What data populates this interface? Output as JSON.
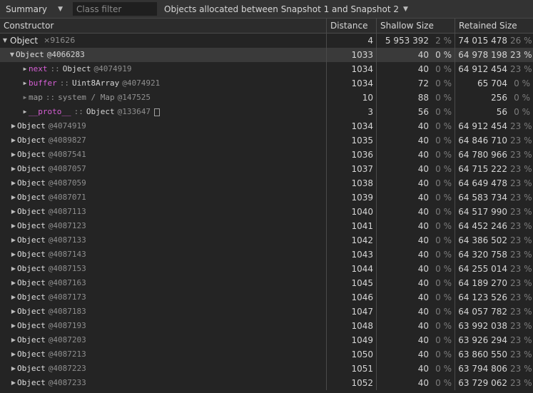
{
  "toolbar": {
    "view_select": "Summary",
    "filter_placeholder": "Class filter",
    "objects_select": "Objects allocated between Snapshot 1 and Snapshot 2"
  },
  "columns": {
    "constructor": "Constructor",
    "distance": "Distance",
    "shallow": "Shallow Size",
    "retained": "Retained Size"
  },
  "root": {
    "name": "Object",
    "count": "×91626",
    "distance": "4",
    "shallow": "5 953 392",
    "shallow_pct": "2 %",
    "retained": "74 015 478",
    "retained_pct": "26 %"
  },
  "selected": {
    "name": "Object",
    "id": "@4066283",
    "distance": "1033",
    "shallow": "40",
    "shallow_pct": "0 %",
    "retained": "64 978 198",
    "retained_pct": "23 %"
  },
  "children": [
    {
      "prop": "next",
      "sep": "::",
      "type": "Object",
      "id": "@4074919",
      "distance": "1034",
      "shallow": "40",
      "shallow_pct": "0 %",
      "retained": "64 912 454",
      "retained_pct": "23 %"
    },
    {
      "prop": "buffer",
      "sep": "::",
      "type": "Uint8Array",
      "id": "@4074921",
      "distance": "1034",
      "shallow": "72",
      "shallow_pct": "0 %",
      "retained": "65 704",
      "retained_pct": "0 %"
    },
    {
      "prop": "map",
      "sep": "::",
      "type": "system / Map",
      "id": "@147525",
      "distance": "10",
      "shallow": "88",
      "shallow_pct": "0 %",
      "retained": "256",
      "retained_pct": "0 %"
    },
    {
      "prop": "__proto__",
      "sep": "::",
      "type": "Object",
      "id": "@133647",
      "distance": "3",
      "shallow": "56",
      "shallow_pct": "0 %",
      "retained": "56",
      "retained_pct": "0 %"
    }
  ],
  "objects": [
    {
      "name": "Object",
      "id": "@4074919",
      "distance": "1034",
      "shallow": "40",
      "shallow_pct": "0 %",
      "retained": "64 912 454",
      "retained_pct": "23 %"
    },
    {
      "name": "Object",
      "id": "@4089827",
      "distance": "1035",
      "shallow": "40",
      "shallow_pct": "0 %",
      "retained": "64 846 710",
      "retained_pct": "23 %"
    },
    {
      "name": "Object",
      "id": "@4087541",
      "distance": "1036",
      "shallow": "40",
      "shallow_pct": "0 %",
      "retained": "64 780 966",
      "retained_pct": "23 %"
    },
    {
      "name": "Object",
      "id": "@4087057",
      "distance": "1037",
      "shallow": "40",
      "shallow_pct": "0 %",
      "retained": "64 715 222",
      "retained_pct": "23 %"
    },
    {
      "name": "Object",
      "id": "@4087059",
      "distance": "1038",
      "shallow": "40",
      "shallow_pct": "0 %",
      "retained": "64 649 478",
      "retained_pct": "23 %"
    },
    {
      "name": "Object",
      "id": "@4087071",
      "distance": "1039",
      "shallow": "40",
      "shallow_pct": "0 %",
      "retained": "64 583 734",
      "retained_pct": "23 %"
    },
    {
      "name": "Object",
      "id": "@4087113",
      "distance": "1040",
      "shallow": "40",
      "shallow_pct": "0 %",
      "retained": "64 517 990",
      "retained_pct": "23 %"
    },
    {
      "name": "Object",
      "id": "@4087123",
      "distance": "1041",
      "shallow": "40",
      "shallow_pct": "0 %",
      "retained": "64 452 246",
      "retained_pct": "23 %"
    },
    {
      "name": "Object",
      "id": "@4087133",
      "distance": "1042",
      "shallow": "40",
      "shallow_pct": "0 %",
      "retained": "64 386 502",
      "retained_pct": "23 %"
    },
    {
      "name": "Object",
      "id": "@4087143",
      "distance": "1043",
      "shallow": "40",
      "shallow_pct": "0 %",
      "retained": "64 320 758",
      "retained_pct": "23 %"
    },
    {
      "name": "Object",
      "id": "@4087153",
      "distance": "1044",
      "shallow": "40",
      "shallow_pct": "0 %",
      "retained": "64 255 014",
      "retained_pct": "23 %"
    },
    {
      "name": "Object",
      "id": "@4087163",
      "distance": "1045",
      "shallow": "40",
      "shallow_pct": "0 %",
      "retained": "64 189 270",
      "retained_pct": "23 %"
    },
    {
      "name": "Object",
      "id": "@4087173",
      "distance": "1046",
      "shallow": "40",
      "shallow_pct": "0 %",
      "retained": "64 123 526",
      "retained_pct": "23 %"
    },
    {
      "name": "Object",
      "id": "@4087183",
      "distance": "1047",
      "shallow": "40",
      "shallow_pct": "0 %",
      "retained": "64 057 782",
      "retained_pct": "23 %"
    },
    {
      "name": "Object",
      "id": "@4087193",
      "distance": "1048",
      "shallow": "40",
      "shallow_pct": "0 %",
      "retained": "63 992 038",
      "retained_pct": "23 %"
    },
    {
      "name": "Object",
      "id": "@4087203",
      "distance": "1049",
      "shallow": "40",
      "shallow_pct": "0 %",
      "retained": "63 926 294",
      "retained_pct": "23 %"
    },
    {
      "name": "Object",
      "id": "@4087213",
      "distance": "1050",
      "shallow": "40",
      "shallow_pct": "0 %",
      "retained": "63 860 550",
      "retained_pct": "23 %"
    },
    {
      "name": "Object",
      "id": "@4087223",
      "distance": "1051",
      "shallow": "40",
      "shallow_pct": "0 %",
      "retained": "63 794 806",
      "retained_pct": "23 %"
    },
    {
      "name": "Object",
      "id": "@4087233",
      "distance": "1052",
      "shallow": "40",
      "shallow_pct": "0 %",
      "retained": "63 729 062",
      "retained_pct": "23 %"
    }
  ],
  "colors": {
    "background": "#242424",
    "toolbar": "#333333",
    "selected_row": "#3a3a3a",
    "property": "#d75fd6"
  }
}
